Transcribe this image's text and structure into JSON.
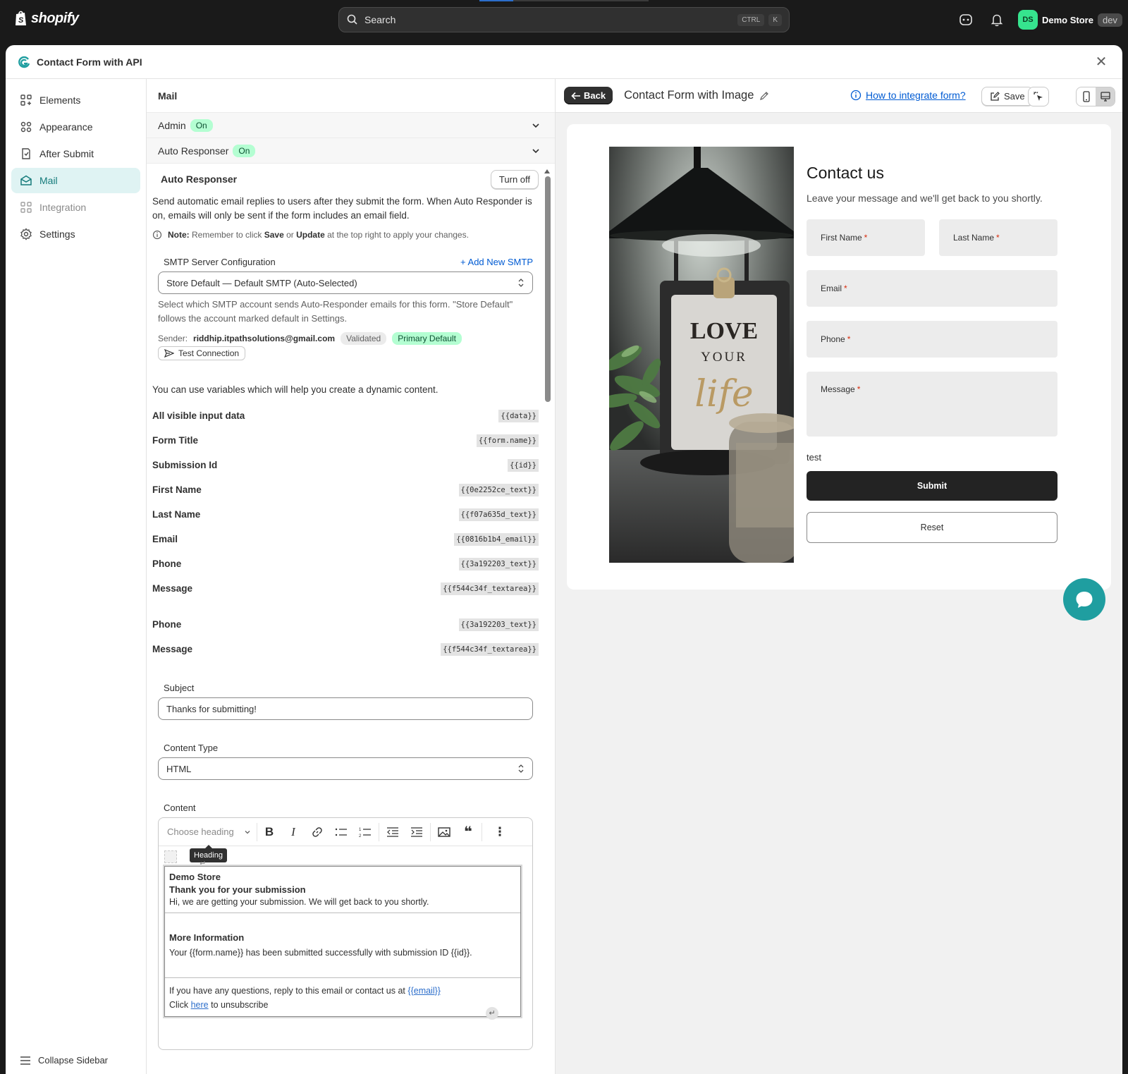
{
  "topbar": {
    "logo_text": "shopify",
    "search_placeholder": "Search",
    "kbd_ctrl": "CTRL",
    "kbd_k": "K",
    "store_initials": "DS",
    "store_name": "Demo Store",
    "store_env": "dev"
  },
  "modal": {
    "title": "Contact Form with API"
  },
  "nav": {
    "items": [
      {
        "label": "Elements"
      },
      {
        "label": "Appearance"
      },
      {
        "label": "After Submit"
      },
      {
        "label": "Mail"
      },
      {
        "label": "Integration"
      },
      {
        "label": "Settings"
      }
    ],
    "collapse_label": "Collapse Sidebar"
  },
  "mail": {
    "title": "Mail",
    "admin_label": "Admin",
    "admin_status": "On",
    "auto_label": "Auto Responser",
    "auto_status": "On",
    "section_title": "Auto Responser",
    "turn_off": "Turn off",
    "description": "Send automatic email replies to users after they submit the form. When Auto Responder is on, emails will only be sent if the form includes an email field.",
    "note_prefix": "Note:",
    "note_a": "Remember to click",
    "note_save": "Save",
    "note_or": "or",
    "note_update": "Update",
    "note_b": "at the top right to apply your changes.",
    "smtp_label": "SMTP Server Configuration",
    "add_smtp": "+ Add New SMTP",
    "smtp_value": "Store Default — Default SMTP (Auto-Selected)",
    "smtp_help": "Select which SMTP account sends Auto-Responder emails for this form. \"Store Default\" follows the account marked default in Settings.",
    "sender_label": "Sender:",
    "sender_email": "riddhip.itpathsolutions@gmail.com",
    "validated": "Validated",
    "primary_default": "Primary Default",
    "test_connection": "Test Connection",
    "vars_intro": "You can use variables which will help you create a dynamic content.",
    "variables": [
      {
        "name": "All visible input data",
        "code": "{{data}}"
      },
      {
        "name": "Form Title",
        "code": "{{form.name}}"
      },
      {
        "name": "Submission Id",
        "code": "{{id}}"
      },
      {
        "name": "First Name",
        "code": "{{0e2252ce_text}}"
      },
      {
        "name": "Last Name",
        "code": "{{f07a635d_text}}"
      },
      {
        "name": "Email",
        "code": "{{0816b1b4_email}}"
      },
      {
        "name": "Phone",
        "code": "{{3a192203_text}}"
      },
      {
        "name": "Message",
        "code": "{{f544c34f_textarea}}"
      },
      {
        "name": "Phone",
        "code": "{{3a192203_text}}"
      },
      {
        "name": "Message",
        "code": "{{f544c34f_textarea}}"
      }
    ],
    "subject_label": "Subject",
    "subject_value": "Thanks for submitting!",
    "content_type_label": "Content Type",
    "content_type_value": "HTML",
    "content_label": "Content",
    "editor": {
      "heading_placeholder": "Choose heading",
      "tooltip": "Heading",
      "store_name": "Demo Store",
      "thanks": "Thank you for your submission",
      "thanks_body": "Hi, we are getting your submission. We will get back to you shortly.",
      "more_title": "More Information",
      "more_body": "Your {{form.name}} has been submitted successfully with submission ID {{id}}.",
      "footer_a": "If you have any questions, reply to this email or contact us at",
      "footer_link": "{{email}}",
      "footer_click": "Click",
      "footer_here": "here",
      "footer_unsub": "to unsubscribe"
    }
  },
  "preview": {
    "back": "Back",
    "title": "Contact Form with Image",
    "integrate_link": "How to integrate form?",
    "save": "Save",
    "form": {
      "title": "Contact us",
      "subtitle": "Leave your message and we'll get back to you shortly.",
      "first_name": "First Name",
      "last_name": "Last Name",
      "email": "Email",
      "phone": "Phone",
      "message": "Message",
      "required_mark": "*",
      "test_text": "test",
      "submit": "Submit",
      "reset": "Reset"
    },
    "photo_text": {
      "love": "LOVE",
      "your": "YOUR",
      "life": "life"
    }
  },
  "colors": {
    "accent": "#157b7b",
    "active_bg": "#dff3f3",
    "badge_green": "#b4fed2",
    "link": "#005bd3",
    "chat": "#1f9ea0"
  }
}
